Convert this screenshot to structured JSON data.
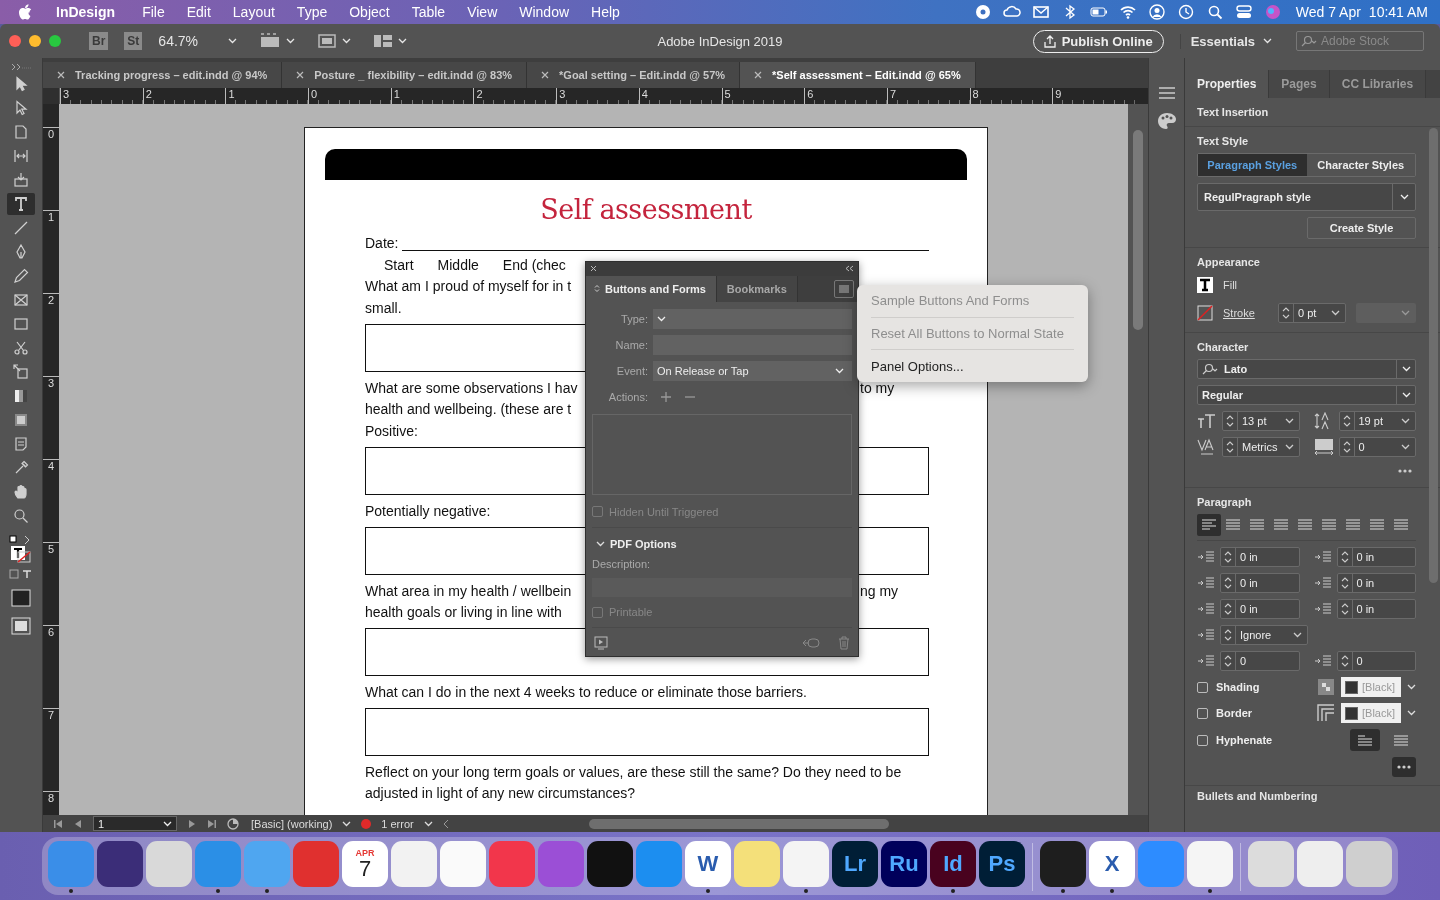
{
  "menu_bar": {
    "app_name": "InDesign",
    "menus": [
      "File",
      "Edit",
      "Layout",
      "Type",
      "Object",
      "Table",
      "View",
      "Window",
      "Help"
    ],
    "date": "Wed 7 Apr",
    "time": "10:41 AM"
  },
  "control_bar": {
    "bridge": "Br",
    "stock": "St",
    "zoom": "64.7%",
    "title": "Adobe InDesign 2019",
    "publish": "Publish Online",
    "workspace": "Essentials",
    "search_placeholder": "Adobe Stock"
  },
  "tools": [
    {
      "kind": "selection",
      "selected": false
    },
    {
      "kind": "direct-selection",
      "selected": false
    },
    {
      "kind": "page",
      "selected": false
    },
    {
      "kind": "gap",
      "selected": false
    },
    {
      "kind": "content-collector",
      "selected": false
    },
    {
      "kind": "type",
      "selected": true
    },
    {
      "kind": "line",
      "selected": false
    },
    {
      "kind": "pen",
      "selected": false
    },
    {
      "kind": "pencil",
      "selected": false
    },
    {
      "kind": "rectangle-frame",
      "selected": false
    },
    {
      "kind": "rectangle",
      "selected": false
    },
    {
      "kind": "scissors",
      "selected": false
    },
    {
      "kind": "free-transform",
      "selected": false
    },
    {
      "kind": "gradient",
      "selected": false
    },
    {
      "kind": "gradient-feather",
      "selected": false
    },
    {
      "kind": "note",
      "selected": false
    },
    {
      "kind": "eyedropper",
      "selected": false
    },
    {
      "kind": "hand",
      "selected": false
    },
    {
      "kind": "zoom",
      "selected": false
    }
  ],
  "doc_tabs": [
    {
      "label": "Tracking progress – edit.indd @ 94%",
      "selected": false
    },
    {
      "label": "Posture _ flexibility – edit.indd @ 83%",
      "selected": false
    },
    {
      "label": "*Goal setting – Edit.indd @ 57%",
      "selected": false
    },
    {
      "label": "*Self assessment – Edit.indd @ 65%",
      "selected": true
    }
  ],
  "ruler": {
    "horizontal": [
      "3",
      "2",
      "1",
      "0",
      "1",
      "2",
      "3",
      "4",
      "5",
      "6",
      "7",
      "8",
      "9"
    ],
    "vertical": [
      "0",
      "1",
      "2",
      "3",
      "4",
      "5",
      "6",
      "7",
      "8"
    ]
  },
  "document": {
    "title": "Self assessment",
    "blocks": [
      {
        "kind": "date",
        "label": "Date:"
      },
      {
        "kind": "stages",
        "labels": [
          "Start",
          "Middle",
          "End (chec"
        ]
      },
      {
        "kind": "split",
        "left": "What am I proud of myself for in t"
      },
      {
        "kind": "split",
        "left": "small."
      },
      {
        "kind": "box"
      },
      {
        "kind": "split",
        "left": "What are some observations I hav",
        "right": "to my"
      },
      {
        "kind": "split",
        "left": "health and wellbeing. (these are t"
      },
      {
        "kind": "split",
        "left": "Positive:"
      },
      {
        "kind": "box"
      },
      {
        "kind": "split",
        "left": "Potentially negative:"
      },
      {
        "kind": "box"
      },
      {
        "kind": "split",
        "left": "What area in my health / wellbein",
        "right": "ng my"
      },
      {
        "kind": "split",
        "left": "health goals or living in line with"
      },
      {
        "kind": "box"
      },
      {
        "kind": "text",
        "text": "What can I do in the next 4 weeks to reduce or eliminate those barriers."
      },
      {
        "kind": "box"
      },
      {
        "kind": "text",
        "text": "Reflect on your long term goals or values, are these still the same? Do they need to be"
      },
      {
        "kind": "text",
        "text": "adjusted in light of any new circumstances?"
      }
    ]
  },
  "status_bar": {
    "page": "1",
    "profile": "[Basic] (working)",
    "errors": "1 error"
  },
  "buttons_panel": {
    "tabs": [
      {
        "label": "Buttons and Forms",
        "selected": true
      },
      {
        "label": "Bookmarks",
        "selected": false
      }
    ],
    "fields": [
      {
        "label": "Type:",
        "kind": "select"
      },
      {
        "label": "Name:",
        "kind": "text"
      },
      {
        "label": "Event:",
        "kind": "select",
        "value": "On Release or Tap"
      }
    ],
    "actions_label": "Actions:",
    "hidden": {
      "label": "Hidden Until Triggered",
      "checked": false,
      "disabled": true
    },
    "pdf_options": {
      "label": "PDF Options",
      "expanded": true
    },
    "description_label": "Description:",
    "printable": {
      "label": "Printable",
      "checked": false,
      "disabled": true
    }
  },
  "panel_menu": [
    {
      "label": "Sample Buttons And Forms",
      "disabled": true
    },
    {
      "label": "Reset All Buttons to Normal State",
      "disabled": true
    },
    {
      "label": "Panel Options...",
      "disabled": false
    }
  ],
  "properties": {
    "tabs": [
      {
        "label": "Properties",
        "selected": true
      },
      {
        "label": "Pages",
        "selected": false
      },
      {
        "label": "CC Libraries",
        "selected": false
      }
    ],
    "text_insertion": "Text Insertion",
    "text_style": {
      "heading": "Text Style",
      "modes": [
        {
          "label": "Paragraph Styles",
          "selected": true
        },
        {
          "label": "Character Styles",
          "selected": false
        }
      ],
      "style": "RegulPragraph style",
      "create": "Create Style"
    },
    "appearance": {
      "heading": "Appearance",
      "fill": "Fill",
      "stroke": "Stroke",
      "stroke_weight": "0 pt"
    },
    "character": {
      "heading": "Character",
      "font": "Lato",
      "style": "Regular",
      "size": "13 pt",
      "leading": "19 pt",
      "kerning": "Metrics",
      "tracking": "0"
    },
    "paragraph": {
      "heading": "Paragraph",
      "alignments": [
        {
          "selected": true
        },
        {
          "selected": false
        },
        {
          "selected": false
        },
        {
          "selected": false
        },
        {
          "selected": false
        },
        {
          "selected": false
        },
        {
          "selected": false
        },
        {
          "selected": false
        },
        {
          "selected": false
        }
      ],
      "field_rows": [
        [
          {
            "kind": "spinner",
            "value": "0 in"
          },
          {
            "kind": "spinner",
            "value": "0 in"
          }
        ],
        [
          {
            "kind": "spinner",
            "value": "0 in"
          },
          {
            "kind": "spinner",
            "value": "0 in"
          }
        ],
        [
          {
            "kind": "spinner",
            "value": "0 in"
          },
          {
            "kind": "spinner",
            "value": "0 in"
          }
        ],
        [
          {
            "kind": "select",
            "value": "Ignore"
          }
        ],
        [
          {
            "kind": "spinner",
            "value": "0"
          },
          {
            "kind": "spinner",
            "value": "0"
          }
        ]
      ],
      "checks": [
        {
          "label": "Shading",
          "checked": false,
          "swatch": "[Black]"
        },
        {
          "label": "Border",
          "checked": false,
          "swatch": "[Black]"
        },
        {
          "label": "Hyphenate",
          "checked": false
        }
      ],
      "layout_buttons": [
        {
          "selected": true
        },
        {
          "selected": false
        }
      ]
    },
    "next_section": "Bullets and Numbering"
  },
  "dock": [
    {
      "kind": "app",
      "color": "#3a8ee8",
      "running": true
    },
    {
      "kind": "app",
      "color": "#3b2d78",
      "running": false
    },
    {
      "kind": "app",
      "color": "#d9d9d9",
      "running": false
    },
    {
      "kind": "app",
      "color": "#2b8fe6",
      "running": true
    },
    {
      "kind": "app",
      "color": "#4fa6f0",
      "running": true
    },
    {
      "kind": "app",
      "color": "#e0302f",
      "running": false
    },
    {
      "kind": "calendar",
      "color": "#ffffff",
      "running": false,
      "month": "APR",
      "day": "7"
    },
    {
      "kind": "app",
      "color": "#f2f2f2",
      "running": false
    },
    {
      "kind": "app",
      "color": "#fafafa",
      "running": false
    },
    {
      "kind": "app",
      "color": "#f2364b",
      "running": false
    },
    {
      "kind": "app",
      "color": "#9b4fd6",
      "running": false
    },
    {
      "kind": "app",
      "color": "#111111",
      "running": false
    },
    {
      "kind": "app",
      "color": "#1c8ef0",
      "running": false
    },
    {
      "kind": "app",
      "color": "#ffffff",
      "running": true,
      "glyph": "W"
    },
    {
      "kind": "app",
      "color": "#f4e07a",
      "running": false
    },
    {
      "kind": "app",
      "color": "#f4f4f4",
      "running": true
    },
    {
      "kind": "app",
      "color": "#001e36",
      "running": false,
      "glyph": "Lr"
    },
    {
      "kind": "app",
      "color": "#00005b",
      "running": false,
      "glyph": "Ru"
    },
    {
      "kind": "app",
      "color": "#49021f",
      "running": true,
      "glyph": "Id"
    },
    {
      "kind": "app",
      "color": "#001e36",
      "running": false,
      "glyph": "Ps"
    },
    {
      "kind": "separator"
    },
    {
      "kind": "app",
      "color": "#1e1e1e",
      "running": true
    },
    {
      "kind": "app",
      "color": "#ffffff",
      "running": true,
      "glyph": "X"
    },
    {
      "kind": "app",
      "color": "#2d8cff",
      "running": false
    },
    {
      "kind": "app",
      "color": "#f5f5f5",
      "running": true
    },
    {
      "kind": "separator"
    },
    {
      "kind": "app",
      "color": "#dcdcdc",
      "running": false
    },
    {
      "kind": "app",
      "color": "#eeeeee",
      "running": false
    },
    {
      "kind": "app",
      "color": "#cfcfcf",
      "running": false
    }
  ]
}
